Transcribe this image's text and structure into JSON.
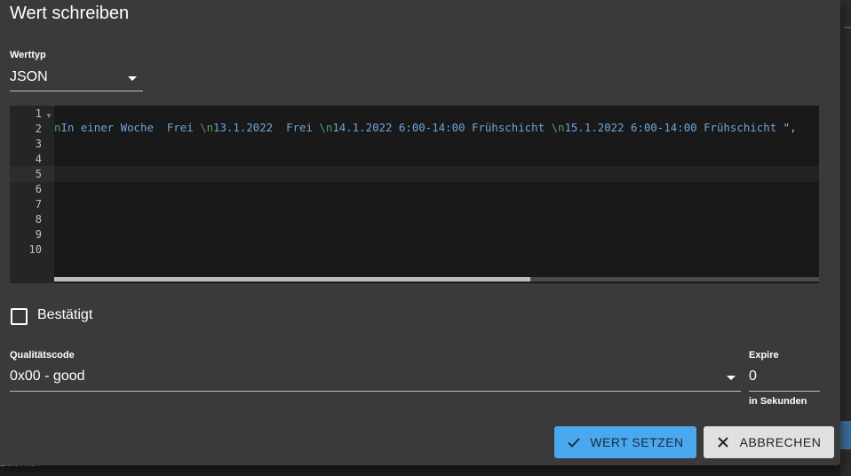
{
  "background": {
    "partial_text": "zaehler"
  },
  "dialog": {
    "title": "Wert schreiben",
    "value_type": {
      "label": "Werttyp",
      "value": "JSON"
    },
    "editor": {
      "line_numbers": [
        "1",
        "2",
        "3",
        "4",
        "5",
        "6",
        "7",
        "8",
        "9",
        "10"
      ],
      "line2": {
        "t1": "In einer Woche  Frei ",
        "e1": "\\n",
        "t2": "13.1.2022  Frei ",
        "e2": "\\n",
        "t3": "14.1.2022 6:00-14:00 Frühschicht ",
        "e3": "\\n",
        "t4": "15.1.2022 6:00-14:00 Frühschicht ",
        "q": "\",",
        "lead": "n"
      }
    },
    "confirmed": {
      "label": "Bestätigt",
      "checked": false
    },
    "quality": {
      "label": "Qualitätscode",
      "value": "0x00 - good"
    },
    "expire": {
      "label": "Expire",
      "value": "0",
      "hint": "in Sekunden"
    },
    "buttons": {
      "set": "WERT SETZEN",
      "cancel": "ABBRECHEN"
    }
  },
  "colors": {
    "primary": "#4aa8ef",
    "dialog_bg": "#3a3a3a",
    "editor_bg": "#191919"
  }
}
